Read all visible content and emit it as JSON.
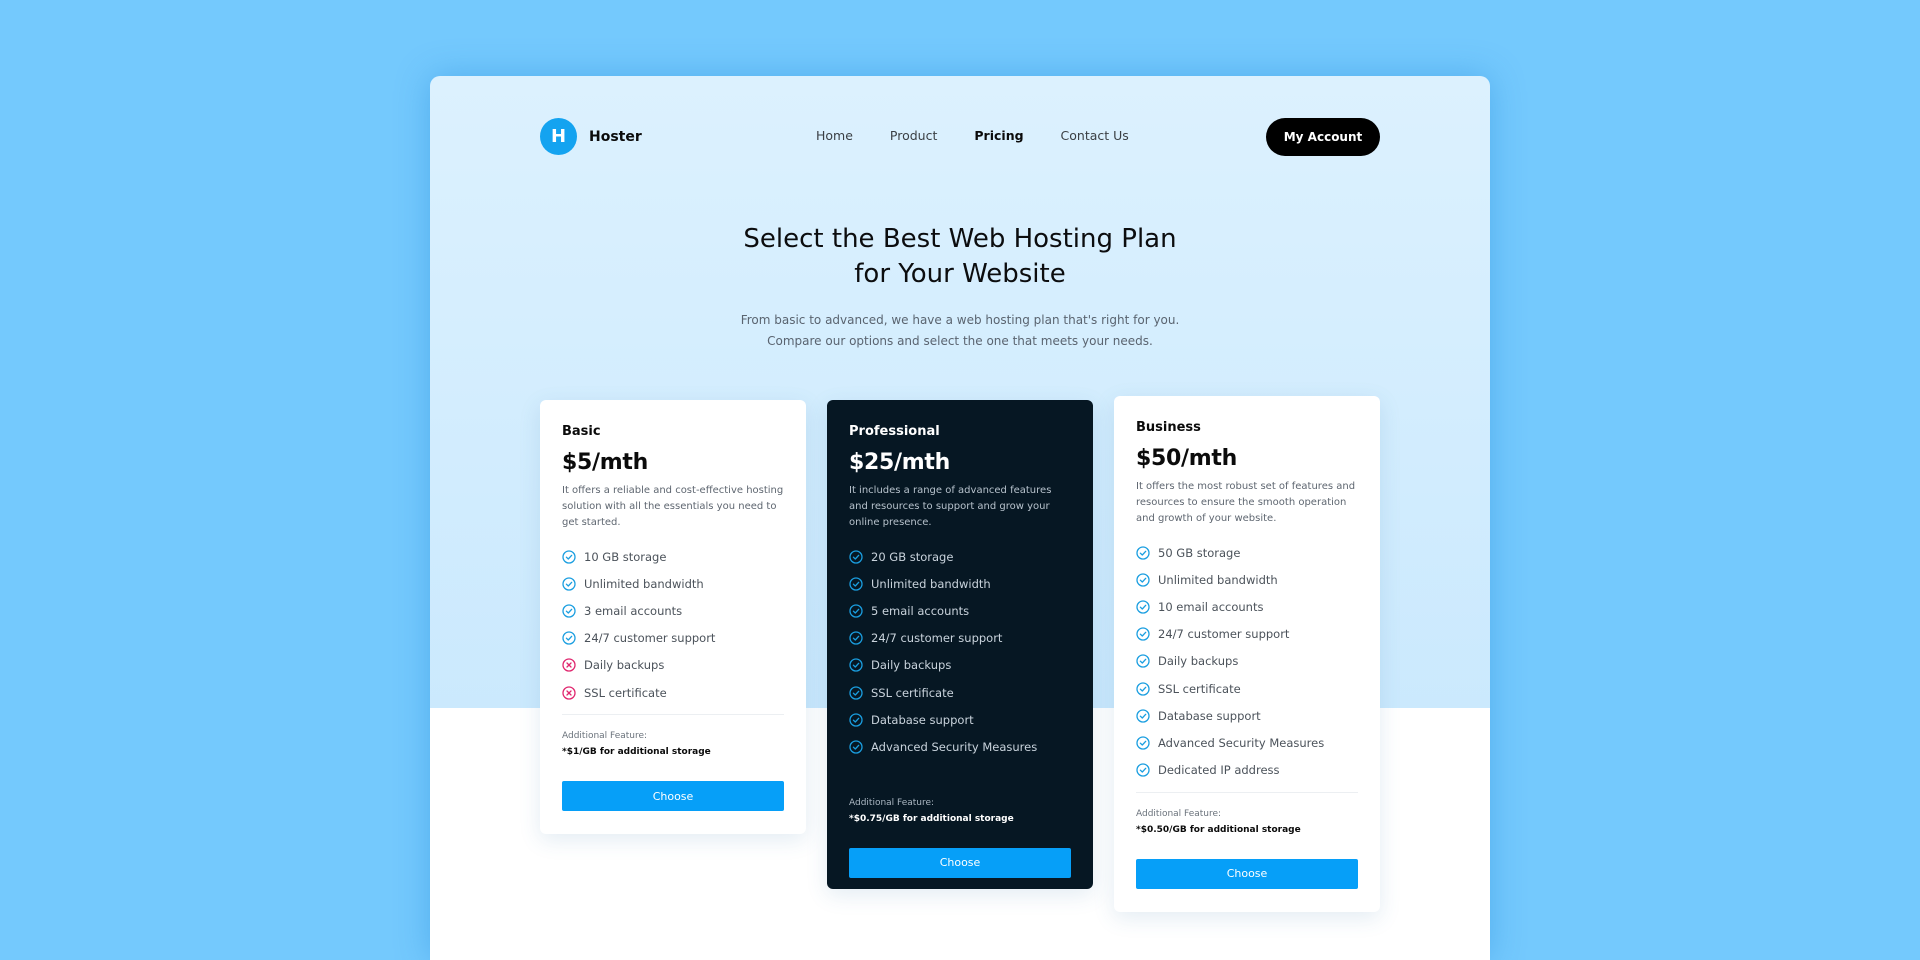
{
  "brand": {
    "logo_letter": "H",
    "name": "Hoster"
  },
  "nav": {
    "items": [
      {
        "label": "Home",
        "active": false
      },
      {
        "label": "Product",
        "active": false
      },
      {
        "label": "Pricing",
        "active": true
      },
      {
        "label": "Contact Us",
        "active": false
      }
    ],
    "account_label": "My Account"
  },
  "hero": {
    "title_line1": "Select the Best Web Hosting Plan",
    "title_line2": "for Your Website",
    "subtitle_line1": "From basic to advanced, we have a web hosting plan that's right for you.",
    "subtitle_line2": "Compare our options and select the one that meets your needs."
  },
  "colors": {
    "accent": "#069ff8",
    "check": "#1a9ee0",
    "cross": "#e0266e",
    "dark_card": "#061723"
  },
  "plans": [
    {
      "name": "Basic",
      "price": "$5/mth",
      "description": "It offers a reliable and cost-effective hosting solution with all the essentials you need to get started.",
      "features": [
        {
          "label": "10 GB storage",
          "included": true,
          "icon": "check-circle-icon"
        },
        {
          "label": "Unlimited bandwidth",
          "included": true,
          "icon": "check-circle-icon"
        },
        {
          "label": "3 email accounts",
          "included": true,
          "icon": "check-circle-icon"
        },
        {
          "label": "24/7 customer support",
          "included": true,
          "icon": "check-circle-icon"
        },
        {
          "label": "Daily backups",
          "included": false,
          "icon": "x-circle-icon"
        },
        {
          "label": "SSL certificate",
          "included": false,
          "icon": "x-circle-icon"
        }
      ],
      "additional_label": "Additional Feature:",
      "additional_value": "*$1/GB for additional storage",
      "button_label": "Choose"
    },
    {
      "name": "Professional",
      "price": "$25/mth",
      "description": "It includes a range of advanced features and resources to support and grow your online presence.",
      "features": [
        {
          "label": "20 GB storage",
          "included": true,
          "icon": "check-circle-icon"
        },
        {
          "label": "Unlimited bandwidth",
          "included": true,
          "icon": "check-circle-icon"
        },
        {
          "label": "5 email accounts",
          "included": true,
          "icon": "check-circle-icon"
        },
        {
          "label": "24/7 customer support",
          "included": true,
          "icon": "check-circle-icon"
        },
        {
          "label": "Daily backups",
          "included": true,
          "icon": "check-circle-icon"
        },
        {
          "label": "SSL certificate",
          "included": true,
          "icon": "check-circle-icon"
        },
        {
          "label": "Database support",
          "included": true,
          "icon": "check-circle-icon"
        },
        {
          "label": "Advanced Security Measures",
          "included": true,
          "icon": "check-circle-icon"
        }
      ],
      "additional_label": "Additional Feature:",
      "additional_value": "*$0.75/GB for additional storage",
      "button_label": "Choose"
    },
    {
      "name": "Business",
      "price": "$50/mth",
      "description": "It offers the most robust set of features and resources to ensure the smooth operation and growth of your website.",
      "features": [
        {
          "label": "50 GB storage",
          "included": true,
          "icon": "check-circle-icon"
        },
        {
          "label": "Unlimited bandwidth",
          "included": true,
          "icon": "check-circle-icon"
        },
        {
          "label": "10 email accounts",
          "included": true,
          "icon": "check-circle-icon"
        },
        {
          "label": "24/7 customer support",
          "included": true,
          "icon": "check-circle-icon"
        },
        {
          "label": "Daily backups",
          "included": true,
          "icon": "check-circle-icon"
        },
        {
          "label": "SSL certificate",
          "included": true,
          "icon": "check-circle-icon"
        },
        {
          "label": "Database support",
          "included": true,
          "icon": "check-circle-icon"
        },
        {
          "label": "Advanced Security Measures",
          "included": true,
          "icon": "check-circle-icon"
        },
        {
          "label": "Dedicated IP address",
          "included": true,
          "icon": "check-circle-icon"
        }
      ],
      "additional_label": "Additional Feature:",
      "additional_value": "*$0.50/GB for additional storage",
      "button_label": "Choose"
    }
  ]
}
